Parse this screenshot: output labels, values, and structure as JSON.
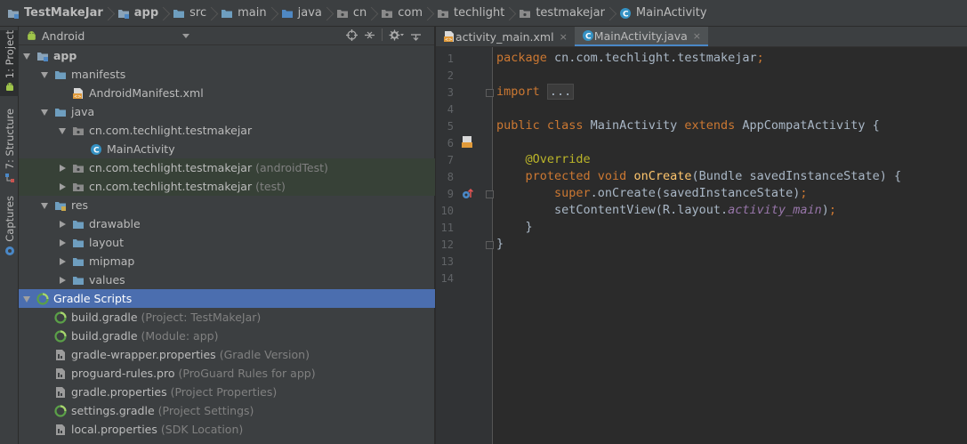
{
  "breadcrumb": [
    {
      "label": "TestMakeJar",
      "icon": "project-folder-icon",
      "bold": true
    },
    {
      "label": "app",
      "icon": "module-folder-icon",
      "bold": true
    },
    {
      "label": "src",
      "icon": "folder-icon"
    },
    {
      "label": "main",
      "icon": "folder-icon"
    },
    {
      "label": "java",
      "icon": "source-folder-icon"
    },
    {
      "label": "cn",
      "icon": "package-icon"
    },
    {
      "label": "com",
      "icon": "package-icon"
    },
    {
      "label": "techlight",
      "icon": "package-icon"
    },
    {
      "label": "testmakejar",
      "icon": "package-icon"
    },
    {
      "label": "MainActivity",
      "icon": "class-icon"
    }
  ],
  "left_strip": {
    "tabs": [
      {
        "label": "1: Project"
      },
      {
        "label": "7: Structure"
      },
      {
        "label": "Captures"
      }
    ]
  },
  "project_panel": {
    "view": "Android",
    "tree": [
      {
        "label": "app",
        "depth": 0,
        "arrow": "down",
        "icon": "module-icon",
        "bold": true
      },
      {
        "label": "manifests",
        "depth": 1,
        "arrow": "down",
        "icon": "folder-icon"
      },
      {
        "label": "AndroidManifest.xml",
        "depth": 2,
        "arrow": "none",
        "icon": "xml-file-icon"
      },
      {
        "label": "java",
        "depth": 1,
        "arrow": "down",
        "icon": "folder-icon"
      },
      {
        "label": "cn.com.techlight.testmakejar",
        "depth": 2,
        "arrow": "down",
        "icon": "package-icon"
      },
      {
        "label": "MainActivity",
        "depth": 3,
        "arrow": "none",
        "icon": "class-icon"
      },
      {
        "label": "cn.com.techlight.testmakejar",
        "hint": "(androidTest)",
        "depth": 2,
        "arrow": "right",
        "icon": "package-icon",
        "hl": true
      },
      {
        "label": "cn.com.techlight.testmakejar",
        "hint": "(test)",
        "depth": 2,
        "arrow": "right",
        "icon": "package-icon",
        "hl": true
      },
      {
        "label": "res",
        "depth": 1,
        "arrow": "down",
        "icon": "res-folder-icon"
      },
      {
        "label": "drawable",
        "depth": 2,
        "arrow": "right",
        "icon": "folder-icon"
      },
      {
        "label": "layout",
        "depth": 2,
        "arrow": "right",
        "icon": "folder-icon"
      },
      {
        "label": "mipmap",
        "depth": 2,
        "arrow": "right",
        "icon": "folder-icon"
      },
      {
        "label": "values",
        "depth": 2,
        "arrow": "right",
        "icon": "folder-icon"
      },
      {
        "label": "Gradle Scripts",
        "depth": 0,
        "arrow": "down",
        "icon": "gradle-icon",
        "selected": true
      },
      {
        "label": "build.gradle",
        "hint": "(Project: TestMakeJar)",
        "depth": 1,
        "arrow": "none",
        "icon": "gradle-icon"
      },
      {
        "label": "build.gradle",
        "hint": "(Module: app)",
        "depth": 1,
        "arrow": "none",
        "icon": "gradle-icon"
      },
      {
        "label": "gradle-wrapper.properties",
        "hint": "(Gradle Version)",
        "depth": 1,
        "arrow": "none",
        "icon": "properties-file-icon"
      },
      {
        "label": "proguard-rules.pro",
        "hint": "(ProGuard Rules for app)",
        "depth": 1,
        "arrow": "none",
        "icon": "properties-file-icon"
      },
      {
        "label": "gradle.properties",
        "hint": "(Project Properties)",
        "depth": 1,
        "arrow": "none",
        "icon": "properties-file-icon"
      },
      {
        "label": "settings.gradle",
        "hint": "(Project Settings)",
        "depth": 1,
        "arrow": "none",
        "icon": "gradle-icon"
      },
      {
        "label": "local.properties",
        "hint": "(SDK Location)",
        "depth": 1,
        "arrow": "none",
        "icon": "properties-file-icon"
      }
    ]
  },
  "editor": {
    "tabs": [
      {
        "label": "activity_main.xml",
        "icon": "xml-file-icon",
        "active": false
      },
      {
        "label": "MainActivity.java",
        "icon": "class-icon",
        "active": true
      }
    ],
    "close_glyph": "×",
    "line_numbers": [
      "1",
      "2",
      "3",
      "4",
      "5",
      "6",
      "7",
      "8",
      "9",
      "10",
      "11",
      "12",
      "13",
      "14"
    ],
    "lines": [
      [
        {
          "t": "package ",
          "c": "kw"
        },
        {
          "t": "cn.com.techlight.testmakejar"
        },
        {
          "t": ";",
          "c": "kw"
        }
      ],
      [],
      [
        {
          "t": "import ",
          "c": "kw"
        },
        {
          "t": "...",
          "c": "folded"
        }
      ],
      [],
      [
        {
          "t": "public class ",
          "c": "kw"
        },
        {
          "t": "MainActivity "
        },
        {
          "t": "extends ",
          "c": "kw"
        },
        {
          "t": "AppCompatActivity {"
        }
      ],
      [],
      [
        {
          "t": "    "
        },
        {
          "t": "@Override",
          "c": "ann"
        }
      ],
      [
        {
          "t": "    "
        },
        {
          "t": "protected void ",
          "c": "kw"
        },
        {
          "t": "onCreate",
          "c": "fn"
        },
        {
          "t": "(Bundle savedInstanceState) {"
        }
      ],
      [
        {
          "t": "        "
        },
        {
          "t": "super",
          "c": "kw"
        },
        {
          "t": ".onCreate(savedInstanceState)"
        },
        {
          "t": ";",
          "c": "kw"
        }
      ],
      [
        {
          "t": "        setContentView(R.layout."
        },
        {
          "t": "activity_main",
          "c": "st"
        },
        {
          "t": ")"
        },
        {
          "t": ";",
          "c": "kw"
        }
      ],
      [
        {
          "t": "    }"
        }
      ],
      [
        {
          "t": "}"
        }
      ],
      [],
      []
    ]
  }
}
